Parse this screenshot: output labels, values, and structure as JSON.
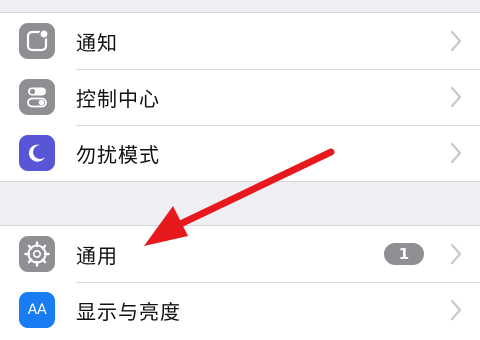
{
  "colors": {
    "background": "#efeff4",
    "icon_gray": "#8e8e93",
    "icon_purple": "#5856d6",
    "icon_blue": "#1a7cf2",
    "badge": "#8e8e93",
    "annotation_arrow": "#e8191c"
  },
  "group1": {
    "rows": [
      {
        "label": "通知",
        "icon": "notifications-icon"
      },
      {
        "label": "控制中心",
        "icon": "control-center-icon"
      },
      {
        "label": "勿扰模式",
        "icon": "do-not-disturb-icon"
      }
    ]
  },
  "group2": {
    "rows": [
      {
        "label": "通用",
        "icon": "general-gear-icon",
        "badge": "1"
      },
      {
        "label": "显示与亮度",
        "icon": "display-brightness-icon",
        "icon_text": "AA"
      }
    ]
  },
  "annotation": {
    "type": "arrow",
    "points_to": "通用"
  }
}
